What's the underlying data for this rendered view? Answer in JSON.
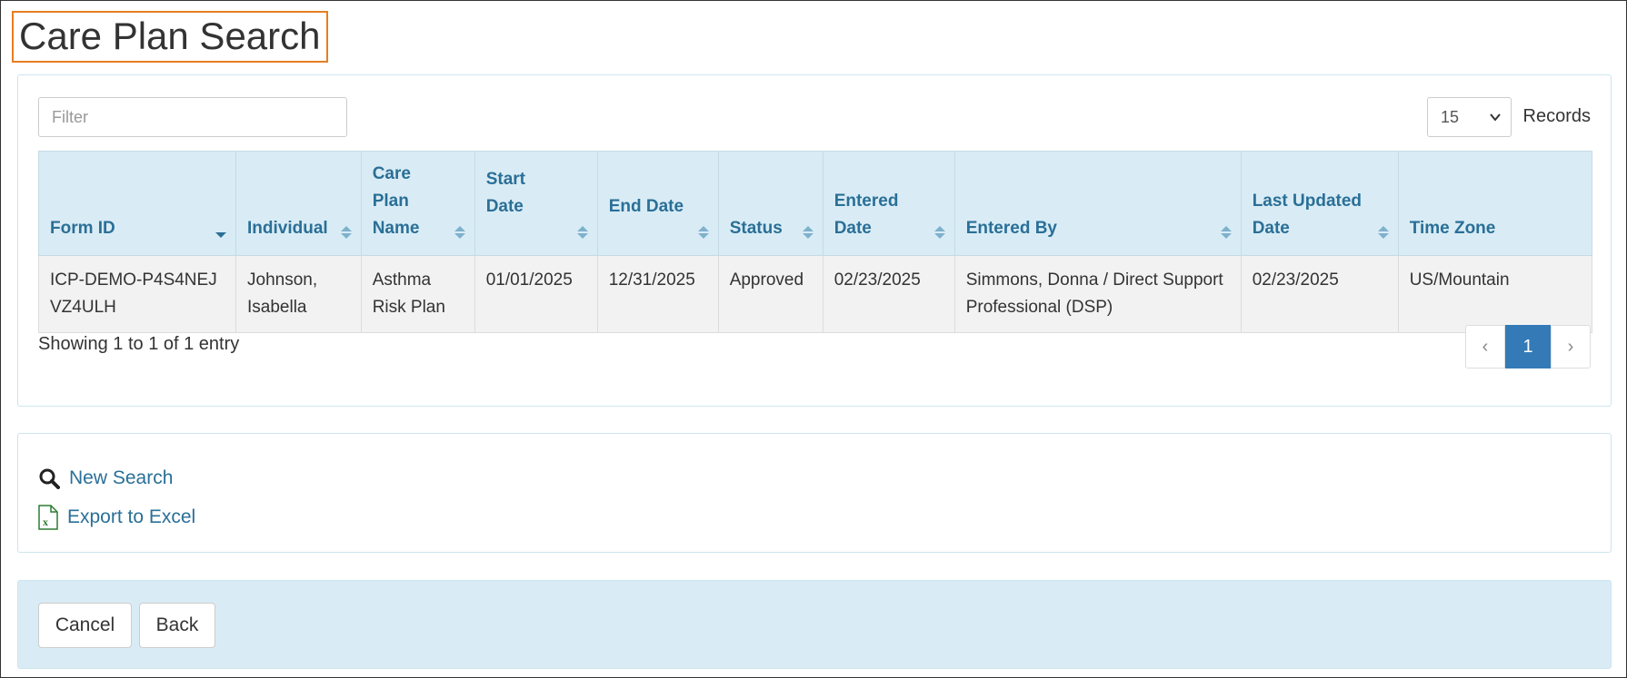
{
  "page": {
    "title": "Care Plan Search"
  },
  "results": {
    "filter_placeholder": "Filter",
    "page_size": "15",
    "records_label": "Records",
    "columns": [
      {
        "label": "Form ID",
        "sort": "desc"
      },
      {
        "label": "Individual",
        "sort": "both"
      },
      {
        "label": "Care Plan Name",
        "sort": "both"
      },
      {
        "label": "Start Date",
        "sort": "both"
      },
      {
        "label": "End Date",
        "sort": "both"
      },
      {
        "label": "Status",
        "sort": "both"
      },
      {
        "label": "Entered Date",
        "sort": "both"
      },
      {
        "label": "Entered By",
        "sort": "both"
      },
      {
        "label": "Last Updated Date",
        "sort": "both"
      },
      {
        "label": "Time Zone",
        "sort": "none"
      }
    ],
    "rows": [
      {
        "form_id": "ICP-DEMO-P4S4NEJVZ4ULH",
        "individual": "Johnson, Isabella",
        "care_plan_name": "Asthma Risk Plan",
        "start_date": "01/01/2025",
        "end_date": "12/31/2025",
        "status": "Approved",
        "entered_date": "02/23/2025",
        "entered_by": "Simmons, Donna / Direct Support Professional (DSP)",
        "last_updated_date": "02/23/2025",
        "time_zone": "US/Mountain"
      }
    ],
    "showing_text": "Showing 1 to 1 of 1 entry",
    "pagination": {
      "prev": "‹",
      "current": "1",
      "next": "›"
    }
  },
  "links": {
    "new_search": "New Search",
    "export_excel": "Export to Excel"
  },
  "actions": {
    "cancel": "Cancel",
    "back": "Back"
  },
  "colors": {
    "accent": "#337ab7",
    "header_bg": "#d9ecf5",
    "header_text": "#2a6f97",
    "title_border": "#e67e22"
  }
}
